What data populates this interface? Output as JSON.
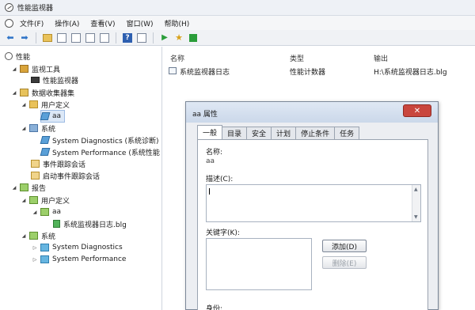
{
  "window": {
    "title": "性能监视器",
    "icon": "performance-monitor-icon"
  },
  "menu": [
    "文件(F)",
    "操作(A)",
    "查看(V)",
    "窗口(W)",
    "帮助(H)"
  ],
  "toolbar": {
    "icons": [
      "back-arrow-icon",
      "forward-arrow-icon",
      "up-folder-icon",
      "show-hide-console-tree-icon",
      "properties-icon",
      "refresh-icon",
      "export-list-icon",
      "help-icon",
      "show-hide-action-pane-icon",
      "start-icon",
      "new-data-collector-set-icon",
      "stop-icon"
    ]
  },
  "tree": {
    "root": "性能",
    "monitoring_tools": "监视工具",
    "performance_monitor": "性能监视器",
    "data_collector_sets": "数据收集器集",
    "user_defined": "用户定义",
    "aa": "aa",
    "system": "系统",
    "system_diagnostics": "System Diagnostics (系统诊断)",
    "system_performance": "System Performance (系统性能",
    "event_trace_sessions": "事件跟踪会话",
    "startup_event_trace_sessions": "启动事件跟踪会话",
    "reports": "报告",
    "report_user_defined": "用户定义",
    "report_aa": "aa",
    "report_file": "系统监视器日志.blg",
    "report_system": "系统",
    "report_system_diagnostics": "System Diagnostics",
    "report_system_performance": "System Performance"
  },
  "list": {
    "columns": {
      "name": "名称",
      "type": "类型",
      "output": "输出"
    },
    "rows": [
      {
        "name": "系统监视器日志",
        "type": "性能计数器",
        "output": "H:\\系统监视器日志.blg"
      }
    ]
  },
  "dialog": {
    "title": "aa 属性",
    "close_label": "✕",
    "tabs": [
      "一般",
      "目录",
      "安全",
      "计划",
      "停止条件",
      "任务"
    ],
    "active_tab": "一般",
    "name_label": "名称:",
    "name_value": "aa",
    "description_label": "描述(C):",
    "description_value": "",
    "keywords_label": "关键字(K):",
    "add_button": "添加(D)",
    "delete_button": "删除(E)",
    "next_label": "身份:"
  }
}
